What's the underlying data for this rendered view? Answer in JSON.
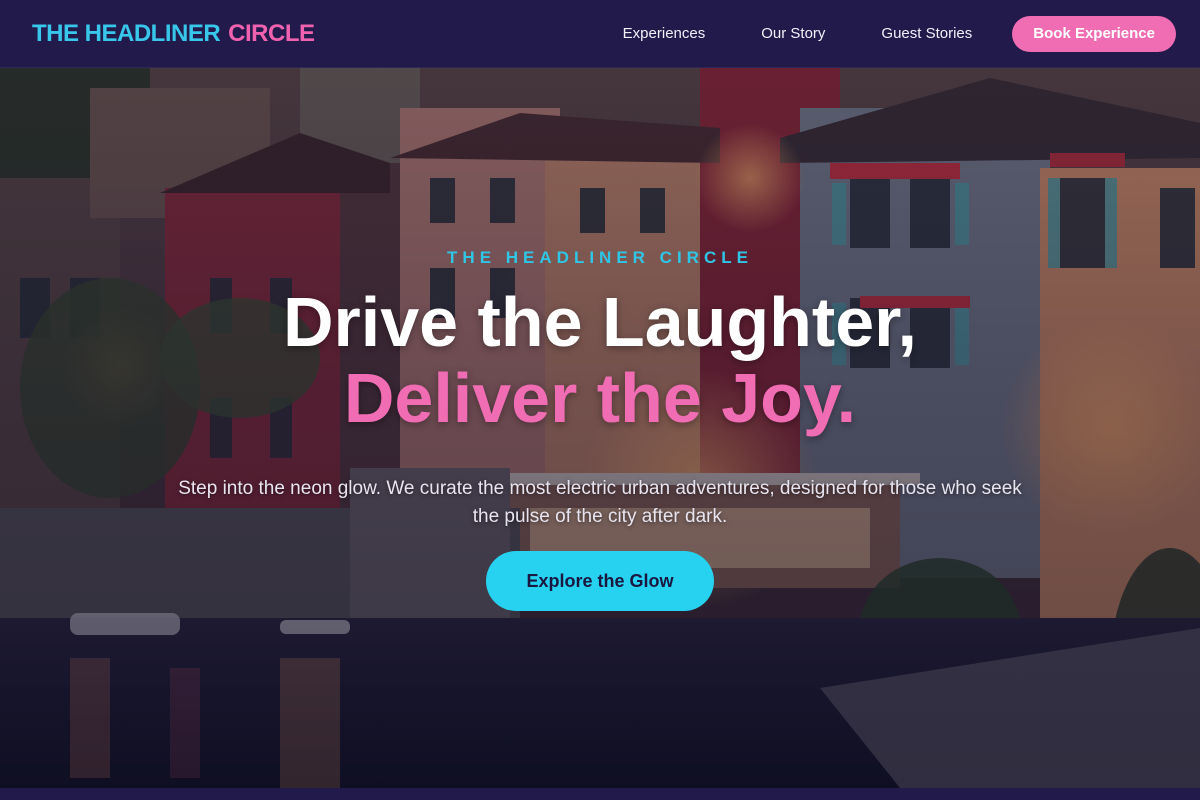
{
  "nav": {
    "logo_part1": "THE HEADLINER",
    "logo_part2": "CIRCLE",
    "links": [
      "Experiences",
      "Our Story",
      "Guest Stories"
    ],
    "cta": "Book Experience"
  },
  "hero": {
    "eyebrow": "THE HEADLINER CIRCLE",
    "headline_line1": "Drive the Laughter,",
    "headline_line2": "Deliver the Joy.",
    "subtitle": "Step into the neon glow. We curate the most electric urban adventures, designed for those who seek the pulse of the city after dark.",
    "cta": "Explore the Glow",
    "background_description_icon": "lakeside-town-photo"
  },
  "colors": {
    "nav_bg": "#211a4b",
    "cyan_accent": "#26d2f0",
    "pink_accent": "#f06cb3"
  }
}
